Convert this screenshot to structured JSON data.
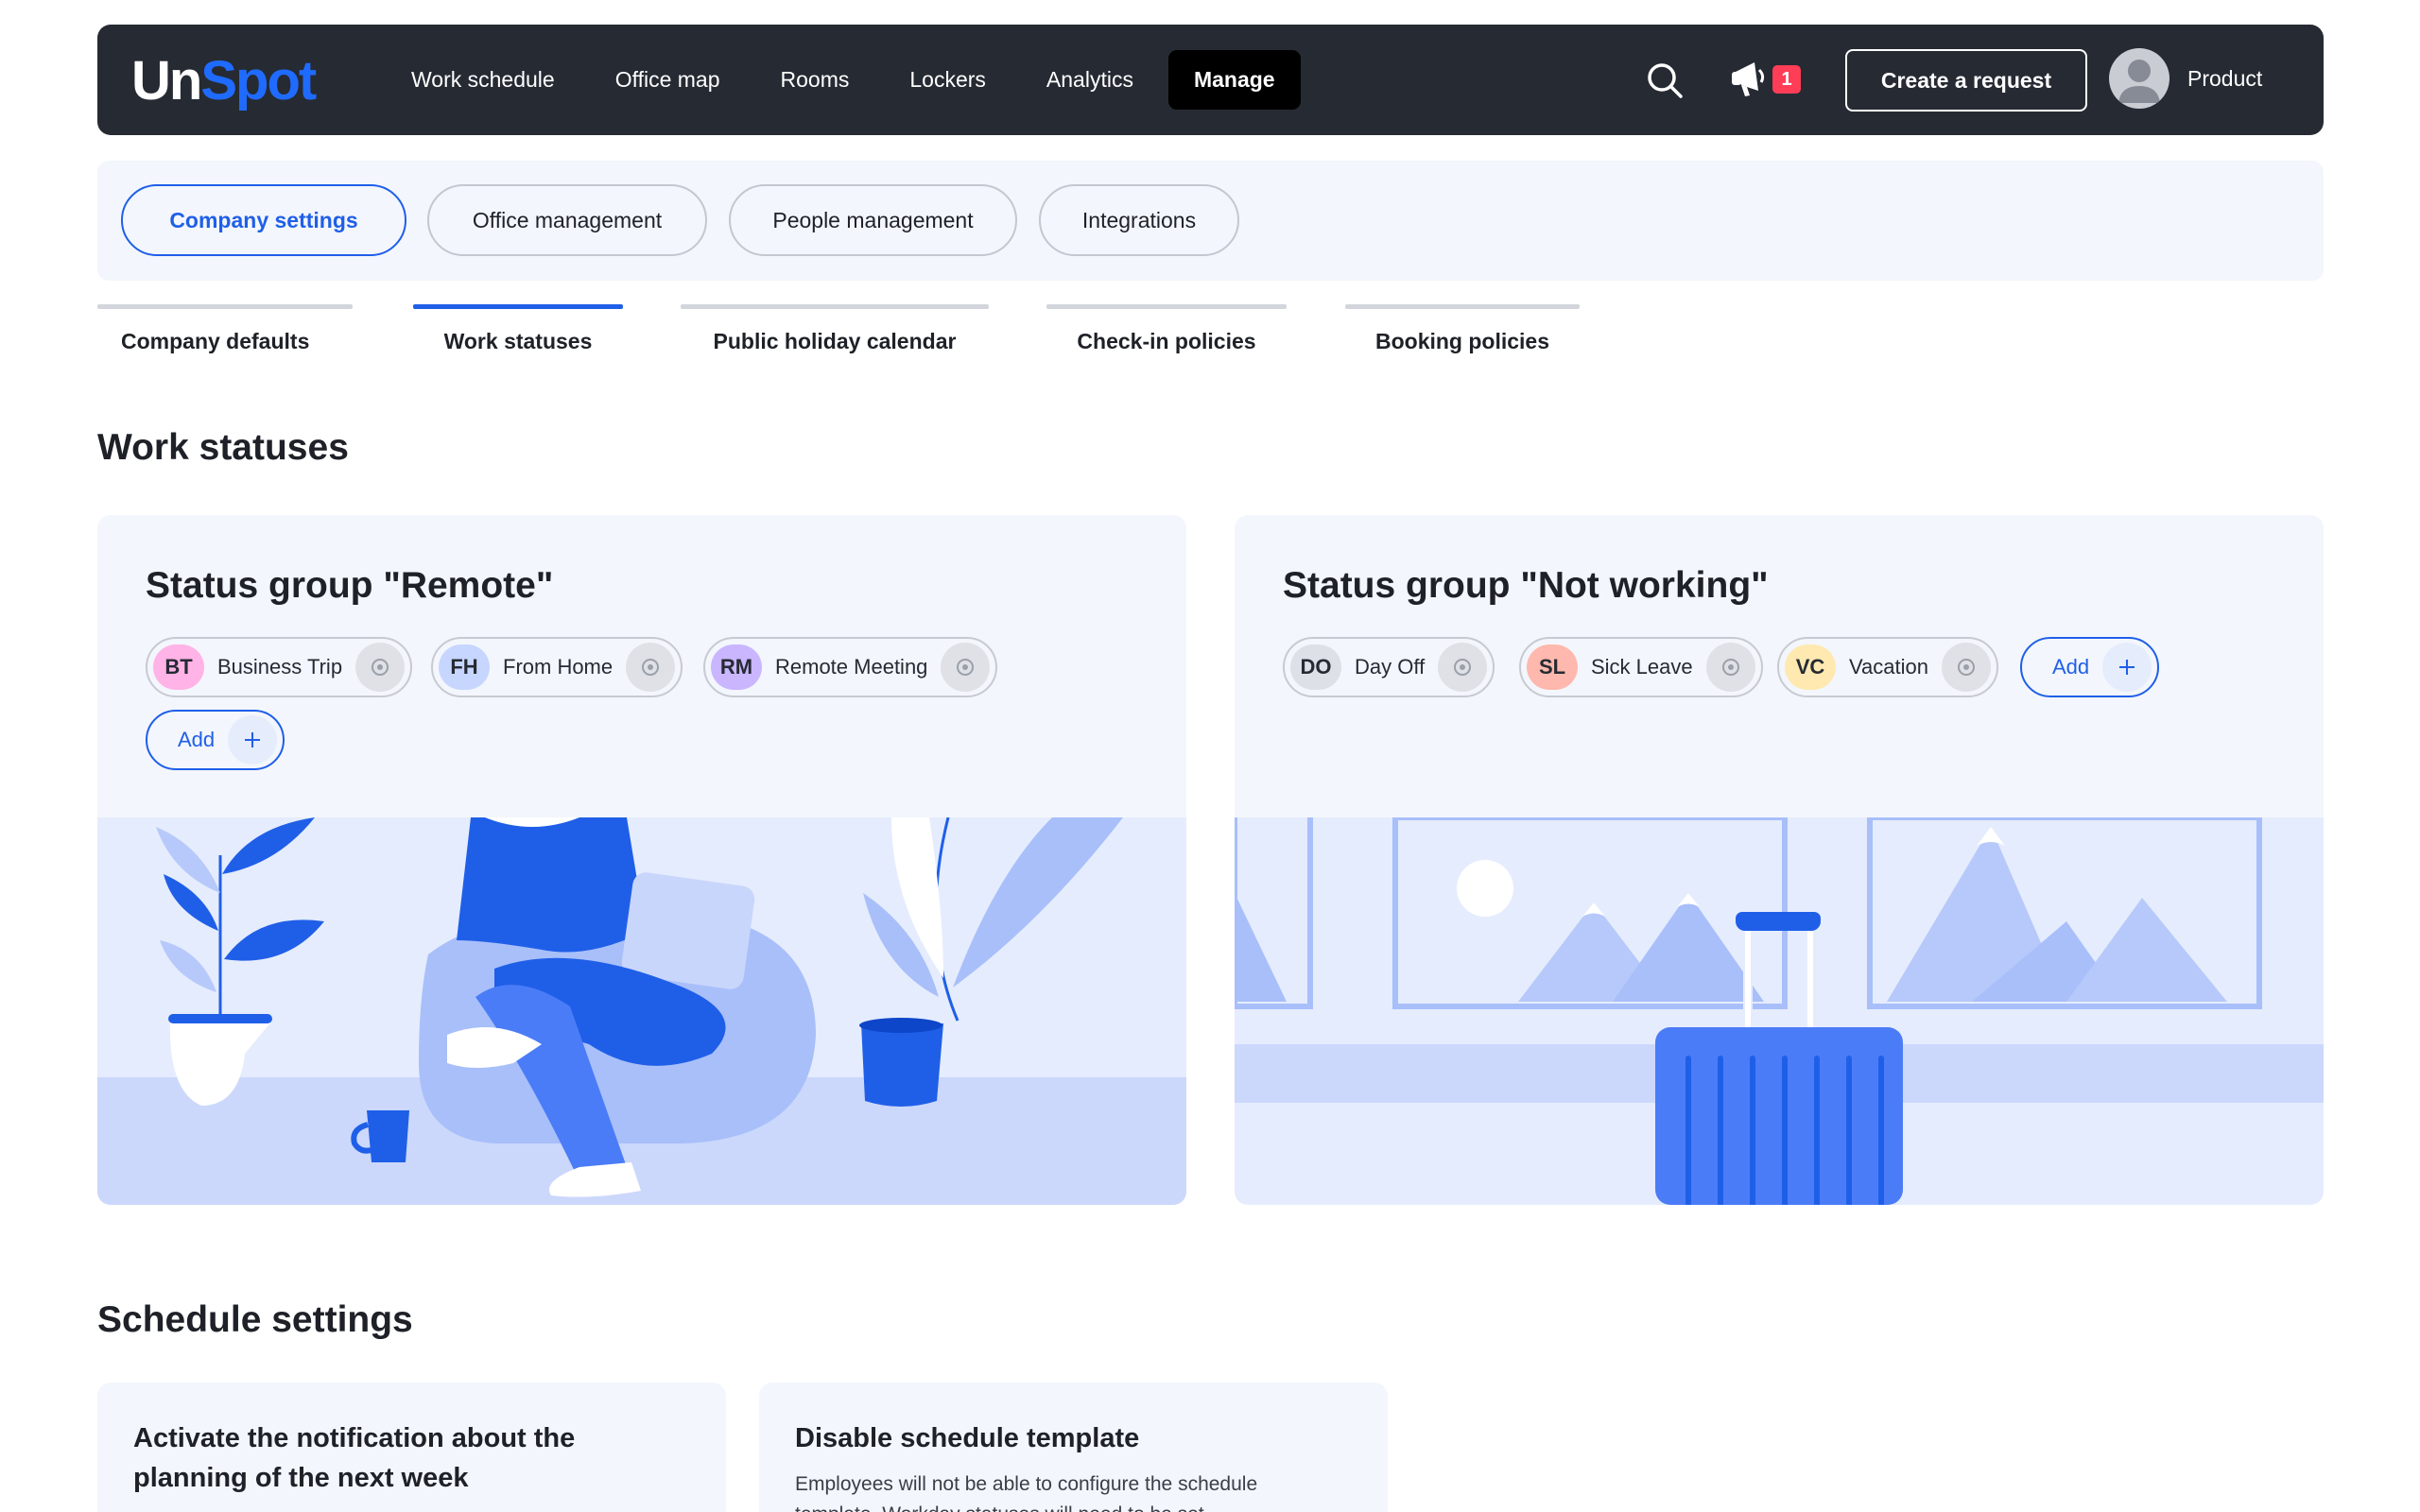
{
  "brand": {
    "part1": "Un",
    "part2": "Spot"
  },
  "nav": {
    "items": [
      "Work schedule",
      "Office map",
      "Rooms",
      "Lockers",
      "Analytics",
      "Manage"
    ],
    "active": "Manage"
  },
  "header": {
    "notifications_count": "1",
    "create_label": "Create a request",
    "user_name": "Product"
  },
  "settings_tabs": [
    "Company settings",
    "Office management",
    "People management",
    "Integrations"
  ],
  "sub_tabs": [
    "Company defaults",
    "Work statuses",
    "Public holiday calendar",
    "Check-in policies",
    "Booking policies"
  ],
  "work_statuses": {
    "heading": "Work statuses",
    "groups": [
      {
        "title": "Status group \"Remote\"",
        "statuses": [
          {
            "abbr": "BT",
            "name": "Business Trip",
            "color": "#ffb3e6"
          },
          {
            "abbr": "FH",
            "name": "From Home",
            "color": "#c6d6ff"
          },
          {
            "abbr": "RM",
            "name": "Remote Meeting",
            "color": "#c9b6ff"
          }
        ],
        "add_label": "Add"
      },
      {
        "title": "Status group \"Not working\"",
        "statuses": [
          {
            "abbr": "DO",
            "name": "Day Off",
            "color": "#dde0e6"
          },
          {
            "abbr": "SL",
            "name": "Sick Leave",
            "color": "#ffb8ad"
          },
          {
            "abbr": "VC",
            "name": "Vacation",
            "color": "#ffe9b0"
          }
        ],
        "add_label": "Add"
      }
    ]
  },
  "schedule_settings": {
    "heading": "Schedule settings",
    "cards": [
      {
        "title_line1": "Activate the notification about the",
        "title_line2": "planning of the next week"
      },
      {
        "title": "Disable schedule template",
        "desc_line1": "Employees will not be able to configure the schedule",
        "desc_line2": "template. Workday statuses will need to be set"
      }
    ]
  },
  "colors": {
    "accent": "#1f5fe8",
    "topbar": "#262a33",
    "card_bg": "#f3f6fc",
    "badge": "#ff3d57"
  }
}
